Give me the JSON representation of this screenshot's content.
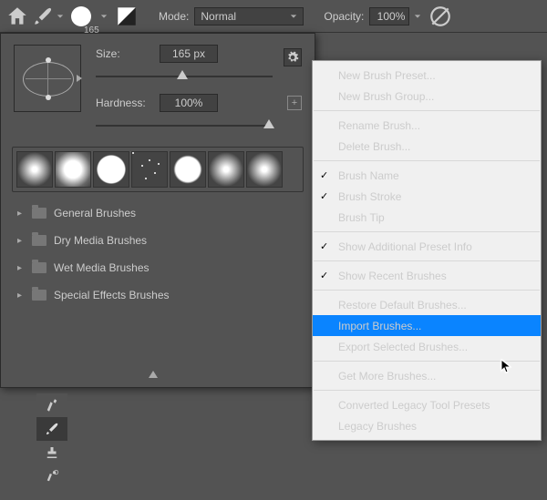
{
  "toolbar": {
    "brush_size_display": "165",
    "mode_label": "Mode:",
    "mode_value": "Normal",
    "opacity_label": "Opacity:",
    "opacity_value": "100%"
  },
  "panel": {
    "size_label": "Size:",
    "size_value": "165 px",
    "hardness_label": "Hardness:",
    "hardness_value": "100%",
    "folders": [
      {
        "label": "General Brushes"
      },
      {
        "label": "Dry Media Brushes"
      },
      {
        "label": "Wet Media Brushes"
      },
      {
        "label": "Special Effects Brushes"
      }
    ]
  },
  "menu": {
    "items": [
      {
        "label": "New Brush Preset...",
        "type": "item"
      },
      {
        "label": "New Brush Group...",
        "type": "item"
      },
      {
        "type": "sep"
      },
      {
        "label": "Rename Brush...",
        "type": "item",
        "disabled": true
      },
      {
        "label": "Delete Brush...",
        "type": "item",
        "disabled": true
      },
      {
        "type": "sep"
      },
      {
        "label": "Brush Name",
        "type": "item",
        "checked": true
      },
      {
        "label": "Brush Stroke",
        "type": "item",
        "checked": true
      },
      {
        "label": "Brush Tip",
        "type": "item"
      },
      {
        "type": "sep"
      },
      {
        "label": "Show Additional Preset Info",
        "type": "item",
        "checked": true
      },
      {
        "type": "sep"
      },
      {
        "label": "Show Recent Brushes",
        "type": "item",
        "checked": true
      },
      {
        "type": "sep"
      },
      {
        "label": "Restore Default Brushes...",
        "type": "item"
      },
      {
        "label": "Import Brushes...",
        "type": "item",
        "highlight": true
      },
      {
        "label": "Export Selected Brushes...",
        "type": "item",
        "disabled": true
      },
      {
        "type": "sep"
      },
      {
        "label": "Get More Brushes...",
        "type": "item"
      },
      {
        "type": "sep"
      },
      {
        "label": "Converted Legacy Tool Presets",
        "type": "item"
      },
      {
        "label": "Legacy Brushes",
        "type": "item"
      }
    ]
  }
}
